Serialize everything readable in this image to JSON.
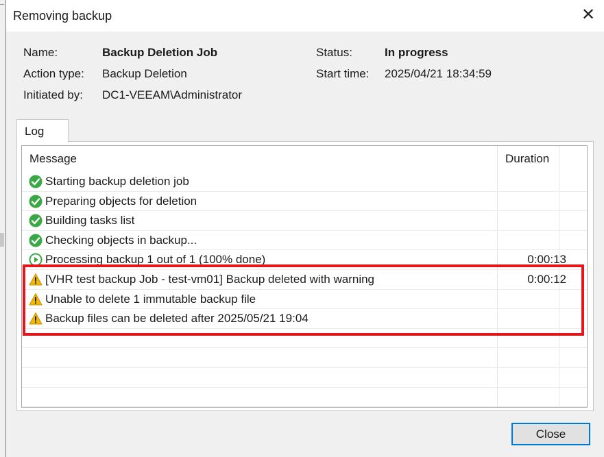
{
  "window": {
    "title": "Removing backup",
    "close_glyph": "✕"
  },
  "details": {
    "name_label": "Name:",
    "name_value": "Backup Deletion Job",
    "action_label": "Action type:",
    "action_value": "Backup Deletion",
    "initiated_label": "Initiated by:",
    "initiated_value": "DC1-VEEAM\\Administrator",
    "status_label": "Status:",
    "status_value": "In progress",
    "start_label": "Start time:",
    "start_value": "2025/04/21 18:34:59"
  },
  "tabs": [
    {
      "label": "Log"
    }
  ],
  "log": {
    "columns": {
      "message": "Message",
      "duration": "Duration"
    },
    "rows": [
      {
        "icon": "success-check-icon",
        "message": "Starting backup deletion job",
        "duration": ""
      },
      {
        "icon": "success-check-icon",
        "message": "Preparing objects for deletion",
        "duration": ""
      },
      {
        "icon": "success-check-icon",
        "message": "Building tasks list",
        "duration": ""
      },
      {
        "icon": "success-check-icon",
        "message": "Checking objects in backup...",
        "duration": ""
      },
      {
        "icon": "in-progress-play-icon",
        "message": "Processing backup 1 out of 1 (100% done)",
        "duration": "0:00:13"
      },
      {
        "icon": "warning-icon",
        "message": "[VHR test backup Job - test-vm01] Backup deleted with warning",
        "duration": "0:00:12"
      },
      {
        "icon": "warning-icon",
        "message": "Unable to delete 1 immutable backup file",
        "duration": ""
      },
      {
        "icon": "warning-icon",
        "message": "Backup files can be deleted after 2025/05/21 19:04",
        "duration": ""
      }
    ]
  },
  "footer": {
    "close_label": "Close"
  },
  "colors": {
    "success": "#3aa845",
    "warning": "#f2b705",
    "highlight": "#e8141b",
    "accent": "#0078d7"
  }
}
